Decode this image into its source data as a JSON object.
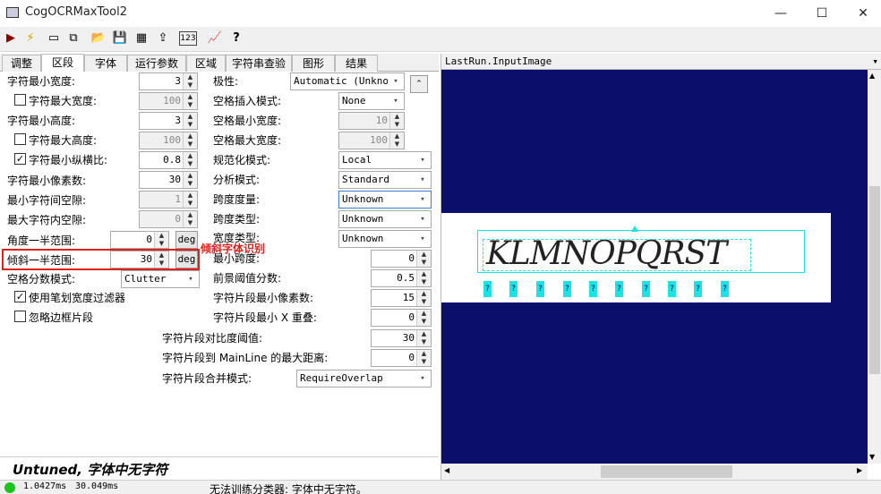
{
  "window": {
    "title": "CogOCRMaxTool2",
    "minimize": "—",
    "maximize": "☐",
    "close": "✕"
  },
  "toolbar": {
    "run": "▶",
    "electric": "⚡",
    "show_image": "▭",
    "copy": "⧉",
    "open": "📂",
    "save": "💾",
    "grid": "▦",
    "import": "⇪",
    "counter": "123",
    "chart": "📈",
    "help": "?"
  },
  "tabs": [
    "调整",
    "区段",
    "字体",
    "运行参数",
    "区域",
    "字符串查验",
    "图形",
    "结果"
  ],
  "left": {
    "char_min_width": {
      "label": "字符最小宽度:",
      "value": "3"
    },
    "char_max_width": {
      "label": "字符最大宽度:",
      "value": "100"
    },
    "char_min_height": {
      "label": "字符最小高度:",
      "value": "3"
    },
    "char_max_height": {
      "label": "字符最大高度:",
      "value": "100"
    },
    "char_min_aspect": {
      "label": "字符最小纵横比:",
      "value": "0.8"
    },
    "char_min_pixels": {
      "label": "字符最小像素数:",
      "value": "30"
    },
    "min_char_gap": {
      "label": "最小字符间空隙:",
      "value": "1"
    },
    "max_intra_gap": {
      "label": "最大字符内空隙:",
      "value": "0"
    },
    "angle_half_range": {
      "label": "角度一半范围:",
      "value": "0",
      "unit": "deg"
    },
    "skew_half_range": {
      "label": "倾斜一半范围:",
      "value": "30",
      "unit": "deg"
    },
    "space_score_mode": {
      "label": "空格分数模式:",
      "value": "Clutter"
    },
    "use_stroke_filter": "使用笔划宽度过滤器",
    "ignore_border": "忽略边框片段"
  },
  "right": {
    "polarity": {
      "label": "极性:",
      "value": "Automatic (Unknown)"
    },
    "space_insert_mode": {
      "label": "空格插入模式:",
      "value": "None"
    },
    "space_min_width": {
      "label": "空格最小宽度:",
      "value": "10"
    },
    "space_max_width": {
      "label": "空格最大宽度:",
      "value": "100"
    },
    "normalize_mode": {
      "label": "规范化模式:",
      "value": "Local"
    },
    "analysis_mode": {
      "label": "分析模式:",
      "value": "Standard"
    },
    "span_metric": {
      "label": "跨度度量:",
      "value": "Unknown"
    },
    "span_type": {
      "label": "跨度类型:",
      "value": "Unknown"
    },
    "width_type": {
      "label": "宽度类型:",
      "value": "Unknown"
    },
    "min_span": {
      "label": "最小跨度:",
      "value": "0"
    },
    "fg_threshold": {
      "label": "前景阈值分数:",
      "value": "0.5"
    },
    "frag_min_pixels": {
      "label": "字符片段最小像素数:",
      "value": "15"
    },
    "frag_min_x_overlap": {
      "label": "字符片段最小 X 重叠:",
      "value": "0"
    },
    "frag_contrast": {
      "label": "字符片段对比度阈值:",
      "value": "30"
    },
    "frag_mainline_dist": {
      "label": "字符片段到 MainLine 的最大距离:",
      "value": "0"
    },
    "frag_merge_mode": {
      "label": "字符片段合并模式:",
      "value": "RequireOverlap"
    }
  },
  "annotation": "倾斜字体识别",
  "status_message": "Untuned, 字体中无字符",
  "statusbar": {
    "time1": "1.0427ms",
    "time2": "30.049ms",
    "msg": "无法训练分类器: 字体中无字符。"
  },
  "image_view": {
    "title": "LastRun.InputImage",
    "text": "KLMNOPQRST",
    "qmark": "?"
  },
  "colors": {
    "canvas_bg": "#0b0e6b",
    "annotation_red": "#e0201c",
    "cyan": "#19e3e3"
  }
}
